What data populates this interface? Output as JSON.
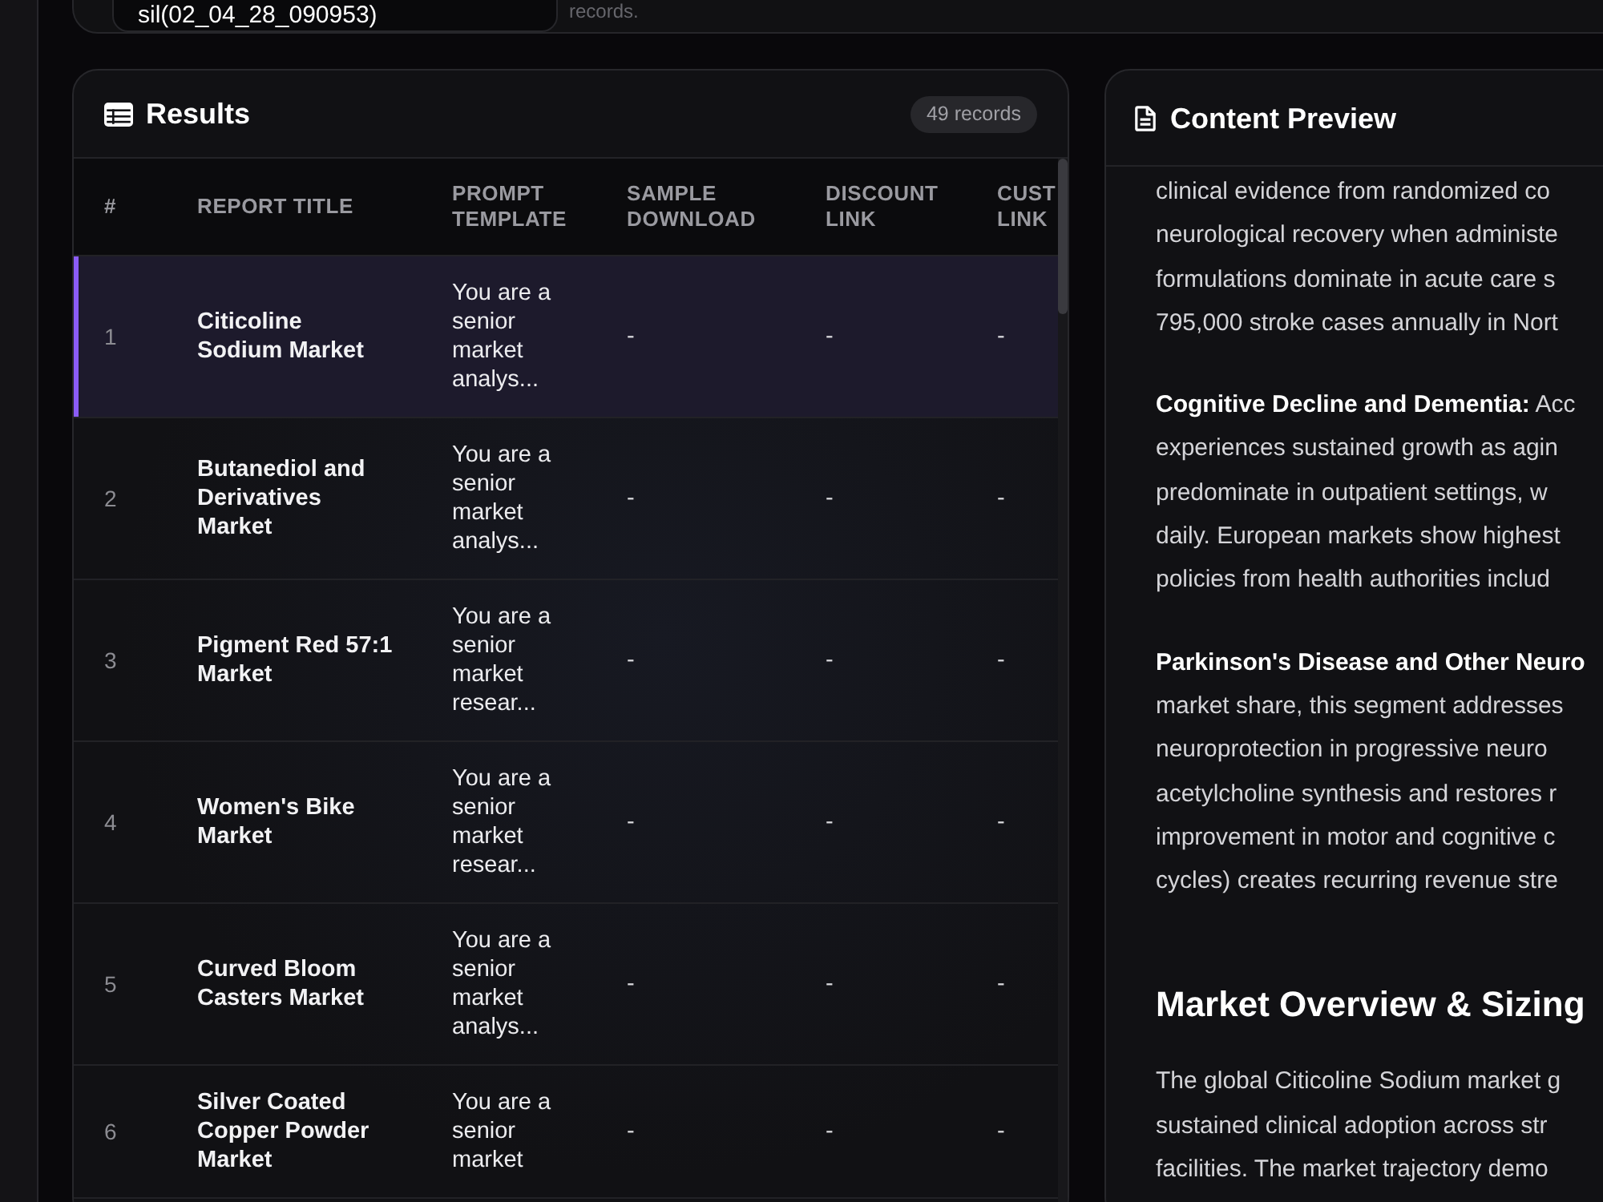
{
  "filter_bar": {
    "search_value": "sil(02_04_28_090953)",
    "hint": "records."
  },
  "results": {
    "title": "Results",
    "record_count": "49 records",
    "columns": [
      "#",
      "REPORT TITLE",
      "PROMPT TEMPLATE",
      "SAMPLE DOWNLOAD",
      "DISCOUNT LINK",
      "CUST LINK"
    ],
    "rows": [
      {
        "number": "1",
        "report_title": "Citicoline Sodium Market",
        "prompt_template": "You are a senior market analys...",
        "sample_download": "-",
        "discount_link": "-",
        "column_6": "-",
        "selected": true
      },
      {
        "number": "2",
        "report_title": "Butanediol and Derivatives Market",
        "prompt_template": "You are a senior market analys...",
        "sample_download": "-",
        "discount_link": "-",
        "column_6": "-",
        "selected": false
      },
      {
        "number": "3",
        "report_title": "Pigment Red 57:1 Market",
        "prompt_template": "You are a senior market resear...",
        "sample_download": "-",
        "discount_link": "-",
        "column_6": "-",
        "selected": false
      },
      {
        "number": "4",
        "report_title": "Women's Bike Market",
        "prompt_template": "You are a senior market resear...",
        "sample_download": "-",
        "discount_link": "-",
        "column_6": "-",
        "selected": false
      },
      {
        "number": "5",
        "report_title": "Curved Bloom Casters Market",
        "prompt_template": "You are a senior market analys...",
        "sample_download": "-",
        "discount_link": "-",
        "column_6": "-",
        "selected": false
      },
      {
        "number": "6",
        "report_title": "Silver Coated Copper Powder Market",
        "prompt_template": "You are a senior market",
        "sample_download": "-",
        "discount_link": "-",
        "column_6": "-",
        "selected": false
      }
    ]
  },
  "content_preview": {
    "title": "Content Preview",
    "blocks": [
      {
        "kind": "paragraph",
        "lines": [
          "clinical evidence from randomized co",
          "neurological recovery when administe",
          "formulations dominate in acute care s",
          "795,000 stroke cases annually in Nort"
        ]
      },
      {
        "kind": "paragraph",
        "lines": [
          "**Cognitive Decline and Dementia:** Acc",
          "experiences sustained growth as agin",
          "predominate in outpatient settings, w",
          "daily. European markets show highest",
          "policies from health authorities includ"
        ]
      },
      {
        "kind": "paragraph",
        "lines": [
          "**Parkinson's Disease and Other Neuro**",
          "market share, this segment addresses",
          "neuroprotection in progressive neuro",
          "acetylcholine synthesis and restores r",
          "improvement in motor and cognitive c",
          "cycles) creates recurring revenue stre"
        ]
      },
      {
        "kind": "heading",
        "text": "Market Overview & Sizing"
      },
      {
        "kind": "paragraph",
        "lines": [
          "The global Citicoline Sodium market g",
          "sustained clinical adoption across str",
          "facilities. The market trajectory demo"
        ]
      }
    ]
  }
}
